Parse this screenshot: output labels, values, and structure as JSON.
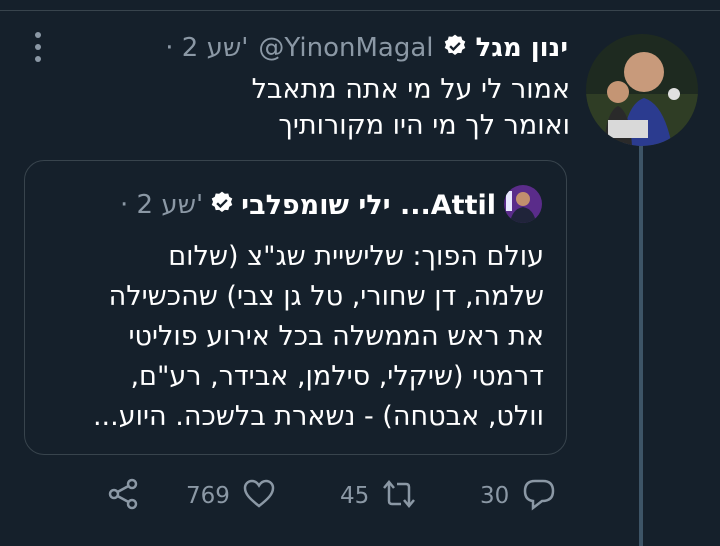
{
  "tweet": {
    "author_name": "ינון מגל",
    "handle": "@YinonMagal",
    "time": "· 2 שע'",
    "lines": [
      "אמור לי על מי אתה מתאבל",
      "ואומר לך מי היו מקורותיך"
    ]
  },
  "quote": {
    "author_name": "ילי שומפלבי ...Attil",
    "time": "· 2 שע'",
    "lines": [
      "עולם הפוך: שלישיית שג\"צ (שלום",
      "שלמה, דן שחורי, טל גן צבי) שהכשילה",
      "את ראש הממשלה בכל אירוע פוליטי",
      "דרמטי (שיקלי, סילמן, אבידר, רע\"ם,",
      "וולט, אבטחה) - נשארת בלשכה. היוע..."
    ]
  },
  "actions": {
    "replies": "30",
    "retweets": "45",
    "likes": "769"
  },
  "icons": {
    "more": "more-vertical-icon",
    "verified": "verified-badge-icon",
    "reply": "reply-icon",
    "retweet": "retweet-icon",
    "like": "heart-icon",
    "share": "share-icon"
  },
  "colors": {
    "background": "#15202b",
    "text": "#ffffff",
    "muted": "#8b98a5",
    "border": "#38444d",
    "thread_line": "#3d5466"
  }
}
